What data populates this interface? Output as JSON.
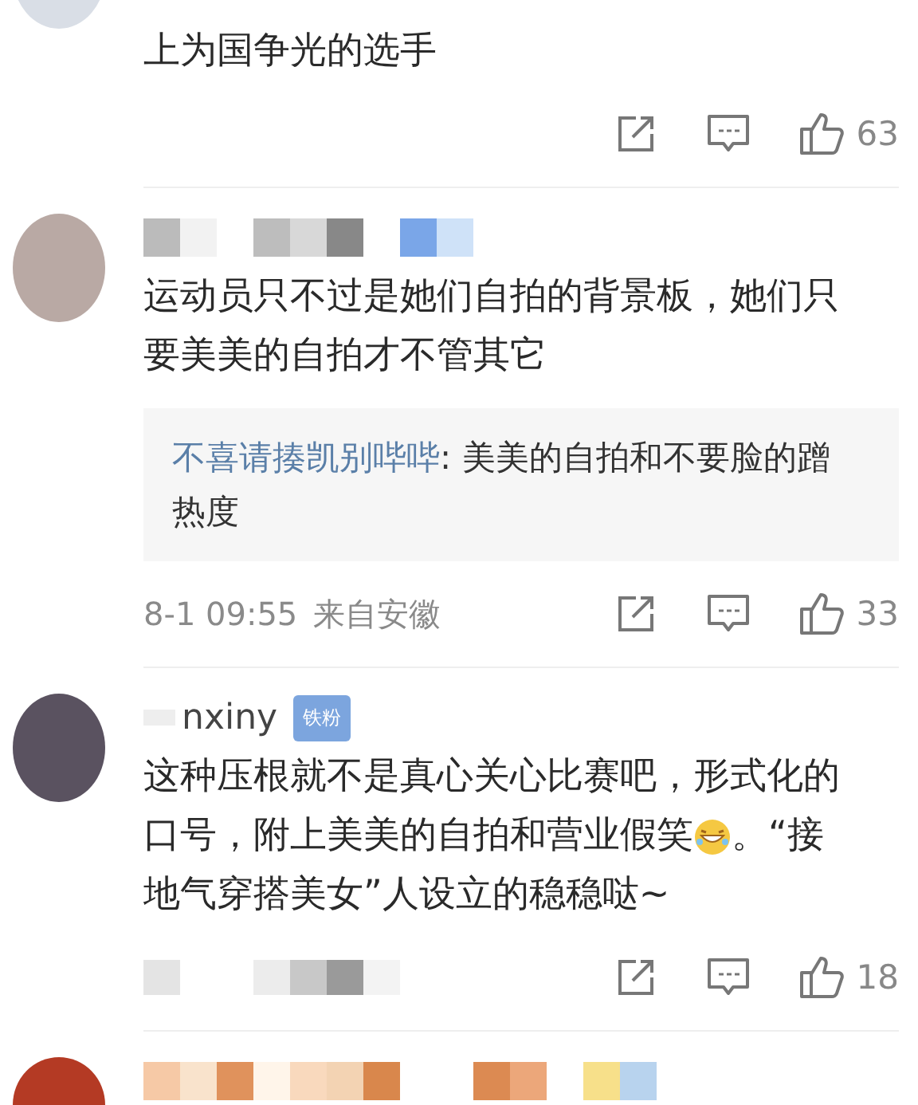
{
  "comments": [
    {
      "kind": "cut",
      "body": [
        [
          {
            "kind": "text",
            "text": "上为国争光的选手"
          }
        ]
      ],
      "likes": "63"
    },
    {
      "kind": "full",
      "body": [
        [
          {
            "kind": "text",
            "text": "运动员只不过是她们自拍的背景板，她们只"
          }
        ],
        [
          {
            "kind": "text",
            "text": "要美美的自拍才不管其它"
          }
        ]
      ],
      "reply": {
        "author": "不喜请揍凯别哔哔",
        "text": ": 美美的自拍和不要脸的蹭热度"
      },
      "time": "8-1 09:55",
      "location": "来自安徽",
      "likes": "33"
    },
    {
      "kind": "full",
      "name": "nxiny",
      "badge": "铁粉",
      "body": [
        [
          {
            "kind": "text",
            "text": "这种压根就不是真心关心比赛吧，形式化的"
          }
        ],
        [
          {
            "kind": "text",
            "text": "口号，附上美美的自拍和营业假笑"
          },
          {
            "kind": "emoji"
          },
          {
            "kind": "text",
            "text": "。“接"
          }
        ],
        [
          {
            "kind": "text",
            "text": "地气穿搭美女”人设立的稳稳哒~"
          }
        ]
      ],
      "likes": "18"
    }
  ]
}
